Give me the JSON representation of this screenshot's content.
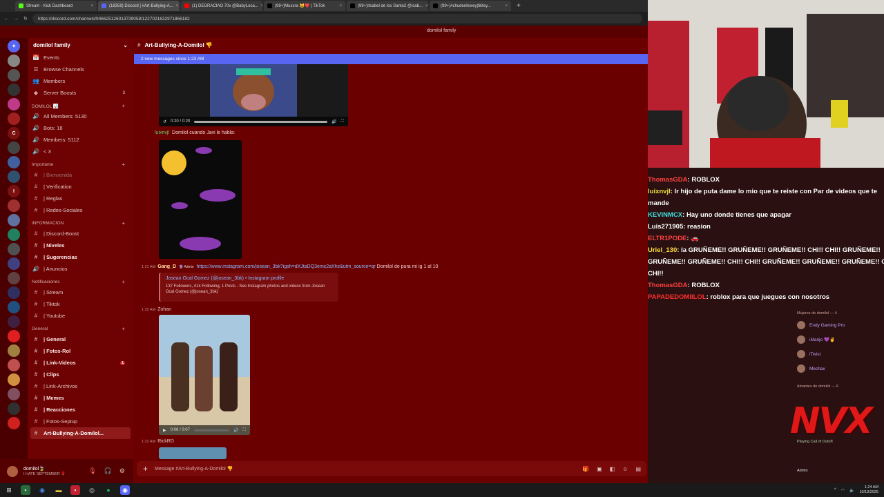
{
  "browser": {
    "tabs": [
      {
        "title": "Stream - Kick Dashboard",
        "color": "#53fc18",
        "active": false
      },
      {
        "title": "(18359) Discord | #Art-Bullying-A...",
        "color": "#5865f2",
        "active": true
      },
      {
        "title": "(1) DEGRACIAO 70x @BabyLoca...",
        "color": "#ff0000",
        "active": false
      },
      {
        "title": "(99+)Muxxra 😺❤️ | TikTok",
        "color": "#000000",
        "active": false
      },
      {
        "title": "(99+)Itsabel de los Santo2 @isab...",
        "color": "#000000",
        "active": false
      },
      {
        "title": "(99+)#chudenlewey|tiktey...",
        "color": "#000000",
        "active": false
      }
    ],
    "url": "https://discord.com/channels/946625126013739058/1227021632971866182"
  },
  "server": {
    "name": "domilol family",
    "topbar_name": "domilol family"
  },
  "channels": {
    "top": [
      {
        "icon": "📅",
        "label": "Events",
        "style": ""
      },
      {
        "icon": "☰",
        "label": "Browse Channels",
        "style": ""
      },
      {
        "icon": "👥",
        "label": "Members",
        "style": ""
      },
      {
        "icon": "◆",
        "label": "Server Boosts",
        "style": "",
        "count": "3"
      }
    ],
    "domilol_cat": "DOMILOL 📊",
    "domilol": [
      {
        "icon": "🔊",
        "label": "All Members: 5130"
      },
      {
        "icon": "🔊",
        "label": "Bots: 18"
      },
      {
        "icon": "🔊",
        "label": "Members: 5112"
      },
      {
        "icon": "🔊",
        "label": "< 3"
      }
    ],
    "importante_cat": "Importante",
    "importante": [
      {
        "icon": "#",
        "label": "| Bienvenida",
        "style": "dim"
      },
      {
        "icon": "#",
        "label": "| Verification",
        "style": ""
      },
      {
        "icon": "#",
        "label": "| Reglas",
        "style": ""
      },
      {
        "icon": "#",
        "label": "| Redes-Sociales",
        "style": ""
      }
    ],
    "informacion_cat": "INFORMACION",
    "informacion": [
      {
        "icon": "#",
        "label": "| Discord-Boost",
        "style": ""
      },
      {
        "icon": "#",
        "label": "| Niveles",
        "style": "bold"
      },
      {
        "icon": "#",
        "label": "| Sugerencias",
        "style": "bold"
      },
      {
        "icon": "🔊",
        "label": "| Anuncios",
        "style": ""
      }
    ],
    "notificaciones_cat": "Notificaciones",
    "notificaciones": [
      {
        "icon": "#",
        "label": "| Stream",
        "style": ""
      },
      {
        "icon": "#",
        "label": "| Tiktok",
        "style": ""
      },
      {
        "icon": "#",
        "label": "| Youtube",
        "style": ""
      }
    ],
    "general_cat": "General",
    "general": [
      {
        "icon": "#",
        "label": "| General",
        "style": "bold"
      },
      {
        "icon": "#",
        "label": "| Fotos-Rol",
        "style": "bold"
      },
      {
        "icon": "#",
        "label": "| Link-Videos",
        "style": "bold",
        "badge": "1"
      },
      {
        "icon": "#",
        "label": "| Clips",
        "style": "bold"
      },
      {
        "icon": "#",
        "label": "| Link-Archivos",
        "style": ""
      },
      {
        "icon": "#",
        "label": "| Memes",
        "style": "bold"
      },
      {
        "icon": "#",
        "label": "| Reacciones",
        "style": "bold"
      },
      {
        "icon": "#",
        "label": "| Fotos-Septup",
        "style": ""
      },
      {
        "icon": "#",
        "label": "Art-Bullying-A-Domilol...",
        "style": "sel"
      }
    ]
  },
  "user": {
    "name": "domilol🍃",
    "status": "I HATE SEPTEMBER 🌹"
  },
  "chat": {
    "channel": "Art-Bullying-A-Domilol 👎",
    "new_messages": "2 new messages since 1:23 AM",
    "video1_time": "0:20 / 0:20",
    "msg1_author": "luixnvjl",
    "msg1_text": "Domilol cuando Javi le habla:",
    "msg2_time": "1:21 AM",
    "msg2_author": "Gang_D",
    "msg2_tag": "🔮 Admin",
    "msg2_link": "https://www.instagram.com/josean_3bk?igsh=dXJtaDQ3emc2aXhz&utm_source=qr",
    "msg2_text": "Domilol de pura mi ig 1 al 10",
    "embed_title": "Josean Ocal Gomez (@josean_3bk) • Instagram profile",
    "embed_desc": "137 Followers, 414 Following, 1 Posts - See Instagram photos and videos from Josean Ocal Gomez (@josean_3bk)",
    "msg3_time": "1:22 AM",
    "msg3_author": "Zohan",
    "video2_time": "0:06 / 0:07",
    "msg4_time": "1:22 AM",
    "msg4_author": "RickRD",
    "composer_placeholder": "Message #Art-Bullying-A-Domilol 👎"
  },
  "twitch_chat": [
    {
      "name": "ThomasGDA",
      "color": "#ff4040",
      "text": ": ROBLOX"
    },
    {
      "name": "luixnvjl",
      "color": "#f0e040",
      "text": ": Ir hijo de puta dame lo mio que te reiste con Par de videos que te"
    },
    {
      "name": "",
      "color": "#ffffff",
      "text": "mande"
    },
    {
      "name": "KEVINMCX",
      "color": "#40e0e0",
      "text": ": Hay uno donde tienes que apagar"
    },
    {
      "name": "Luis271905",
      "color": "#ffffff",
      "text": ": reasion"
    },
    {
      "name": "ELTR1PODE",
      "color": "#ff4040",
      "text": ": 🚗"
    },
    {
      "name": "Uriel_130",
      "color": "#ffe040",
      "text": ": la GRUÑEME!! GRUÑEME!! GRUÑEME!! CHI!! CHI!! GRUÑEME!!"
    },
    {
      "name": "",
      "color": "#ffffff",
      "text": "GRUÑEME!! GRUÑEME!! CHI!! CHI!! GRUÑEME!! GRUÑEME!! GRUÑEME!! CHI!!"
    },
    {
      "name": "",
      "color": "#ffffff",
      "text": "CHI!!"
    },
    {
      "name": "ThomasGDA",
      "color": "#ff4040",
      "text": ": ROBLOX"
    },
    {
      "name": "PAPADEDOMIILOL",
      "color": "#ff3030",
      "text": ": roblox para que juegues con nosotros"
    }
  ],
  "member_list": {
    "mujeres": "Mujeres de domilol — 4",
    "members": [
      {
        "name": "Endy Gaming Pro"
      },
      {
        "name": "iMarijo 💜✌"
      },
      {
        "name": "iTwist"
      },
      {
        "name": "Mechax"
      }
    ],
    "amantes": "Amantes de domilol — 6",
    "playing": "Playing Call of Duty®",
    "admin": "Admin"
  },
  "watermark": "NVX",
  "taskbar": {
    "time": "1:24 AM",
    "date": "10/13/2025"
  }
}
